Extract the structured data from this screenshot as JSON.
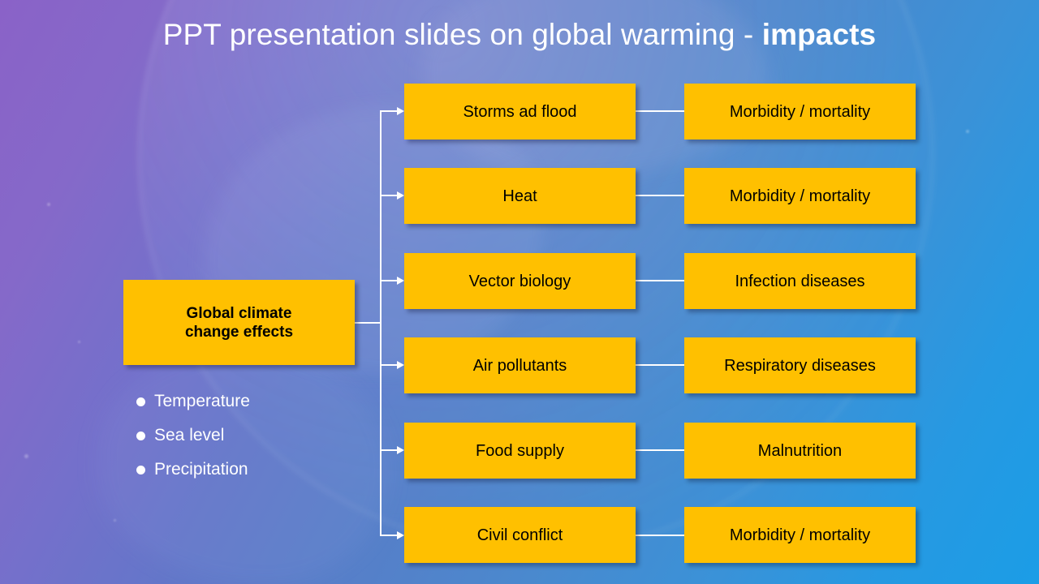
{
  "slide": {
    "title_main": "PPT presentation slides on global warming - ",
    "title_accent": "impacts",
    "background_colors": {
      "top_left": "#8a62c8",
      "bottom_right": "#1b9de6",
      "box_fill": "#ffc000",
      "box_text": "#000000",
      "connector": "#ffffff",
      "title_text": "#ffffff"
    }
  },
  "root": {
    "label": "Global climate\nchange effects",
    "line1": "Global climate",
    "line2": "change effects"
  },
  "bullets": [
    {
      "label": "Temperature"
    },
    {
      "label": "Sea level"
    },
    {
      "label": "Precipitation"
    }
  ],
  "rows": [
    {
      "cause": "Storms ad flood",
      "effect": "Morbidity / mortality"
    },
    {
      "cause": "Heat",
      "effect": "Morbidity / mortality"
    },
    {
      "cause": "Vector biology",
      "effect": "Infection diseases"
    },
    {
      "cause": "Air pollutants",
      "effect": "Respiratory diseases"
    },
    {
      "cause": "Food supply",
      "effect": "Malnutrition"
    },
    {
      "cause": "Civil conflict",
      "effect": "Morbidity / mortality"
    }
  ]
}
